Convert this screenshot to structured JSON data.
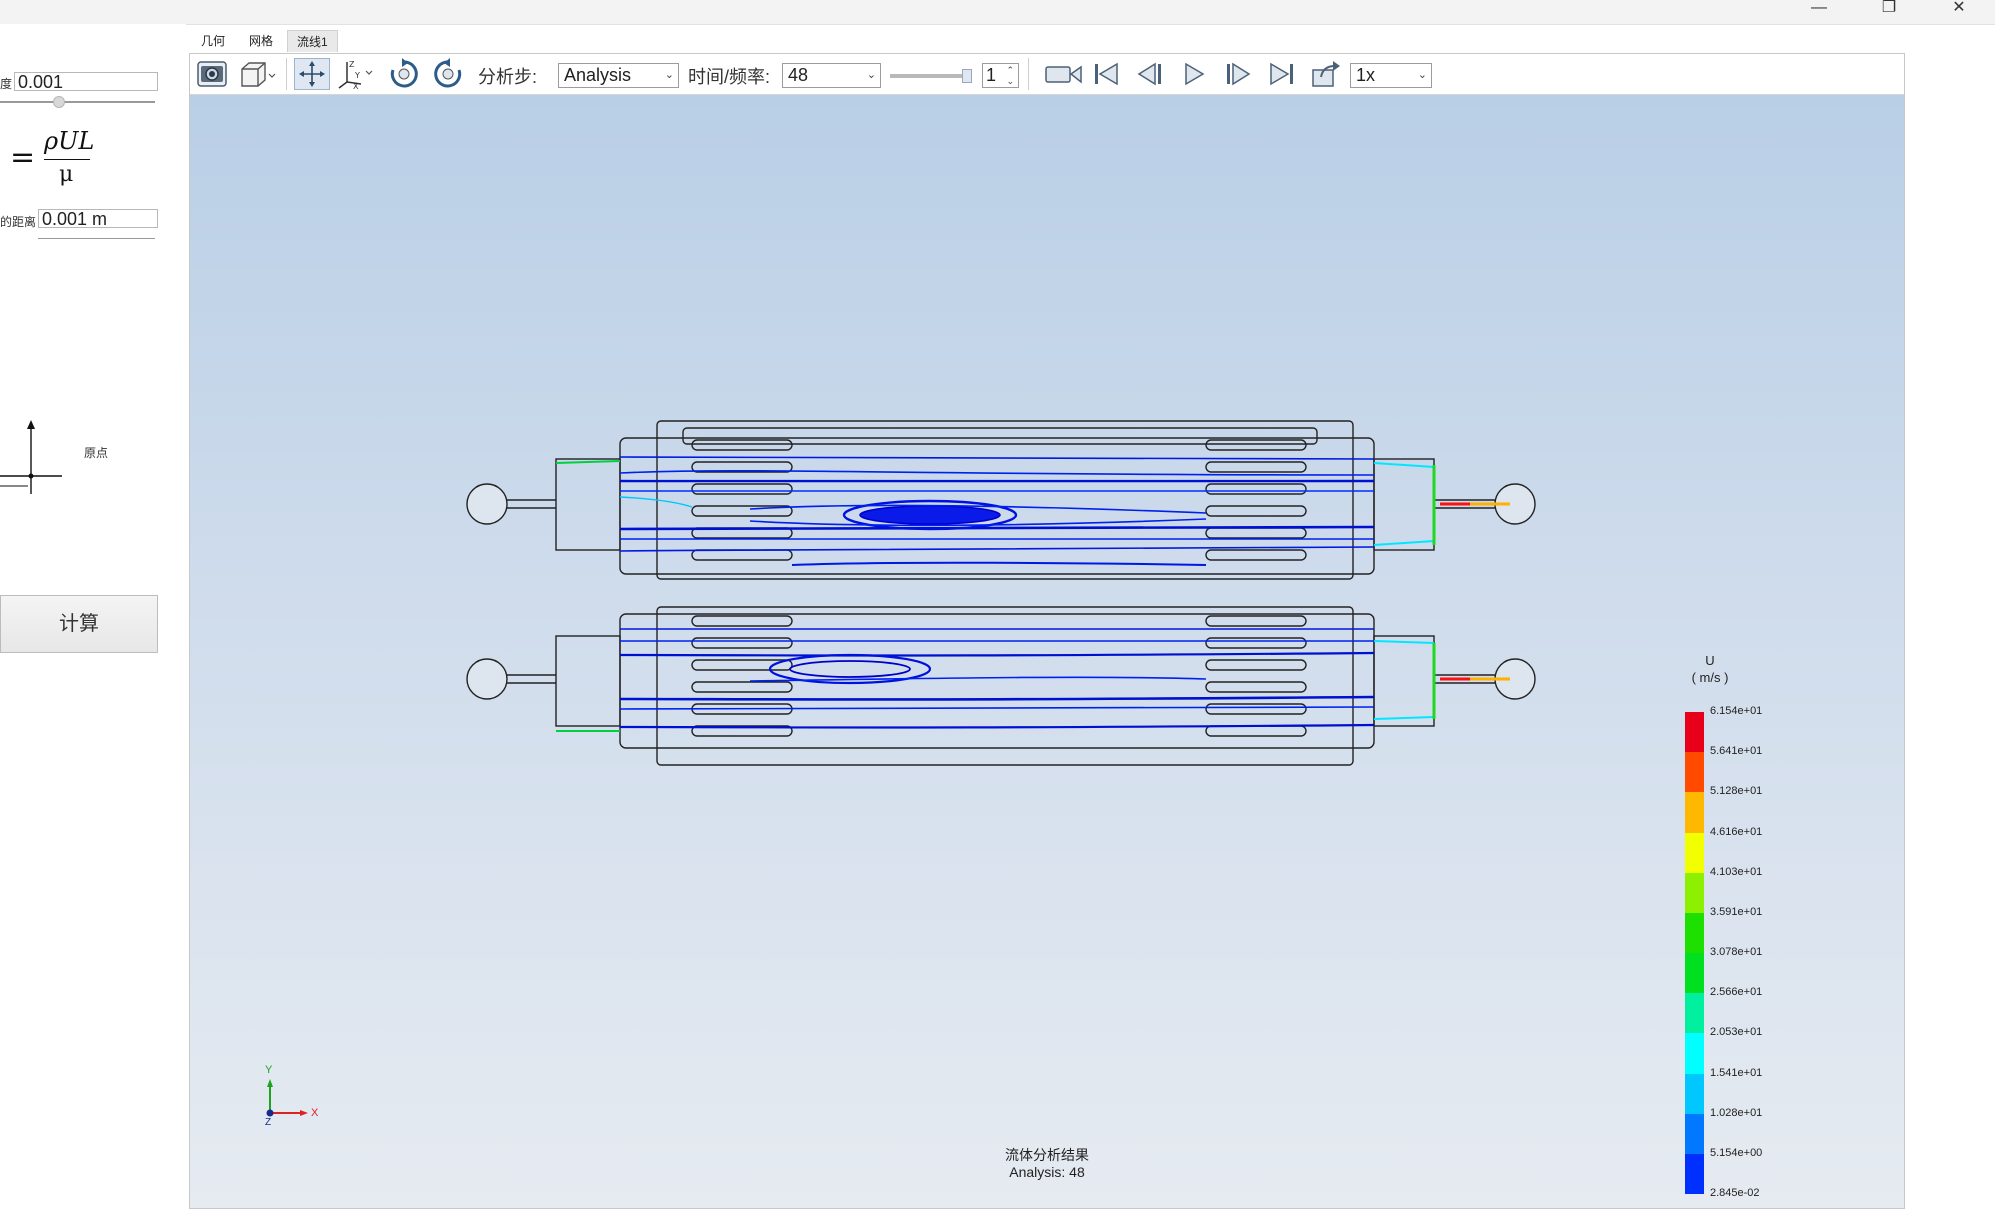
{
  "window": {
    "controls": [
      "—",
      "❐",
      "✕"
    ]
  },
  "left_panel": {
    "density_label": "度",
    "density_value": "0.001",
    "formula_eq": "=",
    "formula_num": "ρUL",
    "formula_den": "μ",
    "length_label": "的距离",
    "length_value": "0.001 m",
    "origin_label": "原点",
    "calc_button": "计算"
  },
  "tabs": [
    {
      "label": "几何"
    },
    {
      "label": "网格"
    },
    {
      "label": "流线1"
    }
  ],
  "toolbar": {
    "analysis_step_label": "分析步:",
    "analysis_select": "Analysis",
    "time_freq_label": "时间/频率:",
    "time_select": "48",
    "frame_spin": "1",
    "speed_select": "1x",
    "icons": [
      "camera-icon",
      "view-cube-icon",
      "fit-view-icon",
      "axis-orient-icon",
      "rotate-cw-icon",
      "rotate-ccw-icon",
      "record-video-icon",
      "first-frame-icon",
      "prev-frame-icon",
      "play-icon",
      "next-frame-icon",
      "last-frame-icon",
      "export-icon"
    ]
  },
  "viewport": {
    "caption_title": "流体分析结果",
    "caption_sub": "Analysis: 48",
    "triad": {
      "x": "X",
      "y": "Y",
      "z": "Z"
    }
  },
  "legend": {
    "title": "U",
    "unit": "( m/s )",
    "colors": [
      "#e8001a",
      "#ff4a00",
      "#ffb800",
      "#f2ff00",
      "#8cf000",
      "#1ee000",
      "#00e020",
      "#00f0a0",
      "#00ffff",
      "#00c8ff",
      "#0078ff",
      "#0030ff",
      "#0000ee"
    ],
    "labels": [
      "6.154e+01",
      "5.641e+01",
      "5.128e+01",
      "4.616e+01",
      "4.103e+01",
      "3.591e+01",
      "3.078e+01",
      "2.566e+01",
      "2.053e+01",
      "1.541e+01",
      "1.028e+01",
      "5.154e+00",
      "2.845e-02"
    ]
  }
}
